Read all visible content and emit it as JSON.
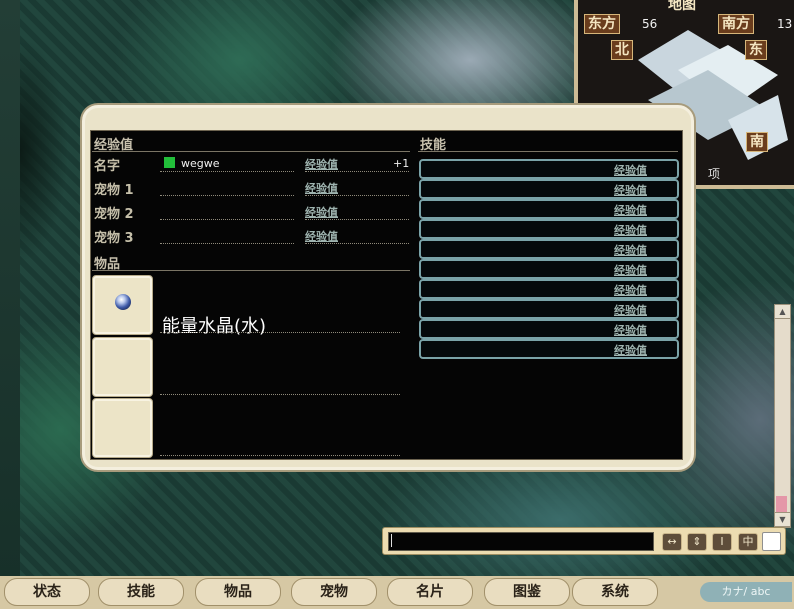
{
  "minimap": {
    "title": "地图",
    "east_label": "东方",
    "east_value": "56",
    "south_label": "南方",
    "south_value": "13",
    "compass_n": "北",
    "compass_e": "东",
    "compass_s": "南",
    "side_text": "项"
  },
  "status": {
    "exp_header": "经验值",
    "skills_header": "技能",
    "items_header": "物品",
    "rows": [
      {
        "label": "名字",
        "value": "wegwe",
        "exp_label": "经验值",
        "exp_value": "+1"
      },
      {
        "label": "宠物 1",
        "value": "",
        "exp_label": "经验值",
        "exp_value": ""
      },
      {
        "label": "宠物 2",
        "value": "",
        "exp_label": "经验值",
        "exp_value": ""
      },
      {
        "label": "宠物 3",
        "value": "",
        "exp_label": "经验值",
        "exp_value": ""
      }
    ],
    "skills": [
      "经验值",
      "经验值",
      "经验值",
      "经验值",
      "经验值",
      "经验值",
      "经验值",
      "经验值",
      "经验值",
      "经验值"
    ],
    "items": [
      {
        "name": "能量水晶(水)",
        "icon": "water-crystal-icon"
      },
      {
        "name": "",
        "icon": ""
      },
      {
        "name": "",
        "icon": ""
      }
    ]
  },
  "chat": {
    "input_value": "",
    "buttons": [
      "↔",
      "⇕",
      "Ⅰ",
      "中"
    ]
  },
  "tabs": [
    "状态",
    "技能",
    "物品",
    "宠物",
    "名片",
    "图鉴",
    "系统"
  ],
  "ime": "カナ/ abc",
  "colors": {
    "accent": "#22bf3a",
    "panel": "#050505",
    "frame": "#eae3c9"
  }
}
